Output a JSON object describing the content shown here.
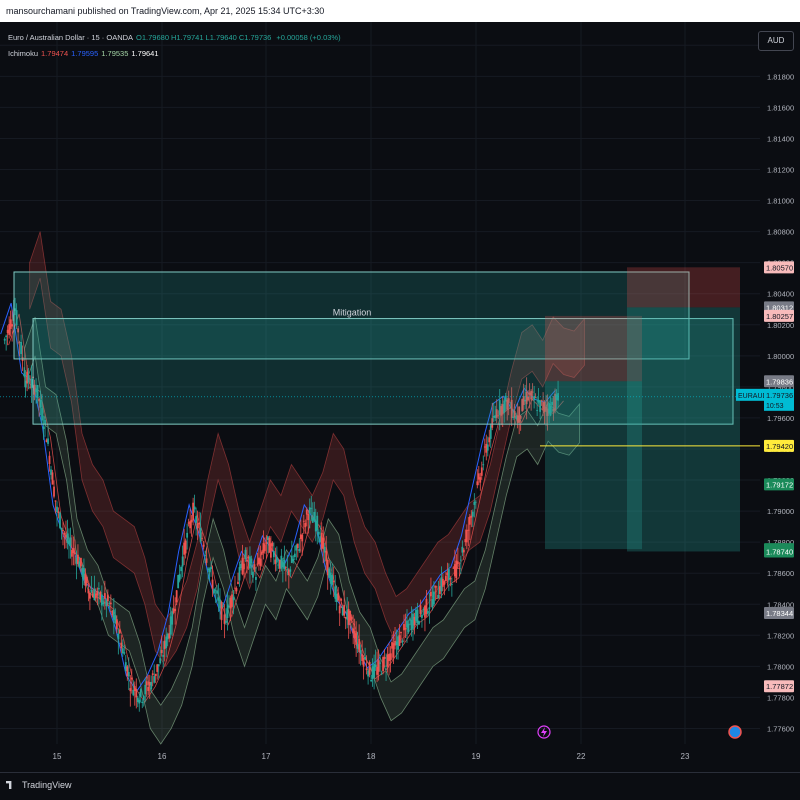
{
  "header": {
    "published_text": "mansourchamani published on TradingView.com, Apr 21, 2025 15:34 UTC+3:30"
  },
  "legend": {
    "symbol_line": "Euro / Australian Dollar · 15 · OANDA",
    "ohlc": [
      {
        "label": "O",
        "value": "1.79680"
      },
      {
        "label": "H",
        "value": "1.79741"
      },
      {
        "label": "L",
        "value": "1.79640"
      },
      {
        "label": "C",
        "value": "1.79736"
      }
    ],
    "change": "+0.00058 (+0.03%)",
    "indicator_name": "Ichimoku",
    "indicator_values": [
      "1.79474",
      "1.79595",
      "1.79535",
      "1.79641"
    ],
    "indicator_colors": [
      "#ef5350",
      "#2962ff",
      "#a5d6a7",
      "#ffffff"
    ]
  },
  "currency_button": "AUD",
  "footer": {
    "logo_text": "TradingView"
  },
  "colors": {
    "up": "#26a69a",
    "down": "#ef5350",
    "zone_fill": "#26a69a",
    "zone_border": "#80cbc4",
    "last_price": "#00bcd4",
    "level_line": "#ffeb3b",
    "background": "#0b0d12"
  },
  "icons": [
    "lightning-icon",
    "calendar-event-icon",
    "tradingview-logo-icon"
  ],
  "chart_data": {
    "type": "candlestick",
    "symbol": "EURAUD",
    "interval": "15",
    "y_range": [
      1.775,
      1.8215
    ],
    "price_ticks": [
      "1.82000",
      "1.81800",
      "1.81600",
      "1.81400",
      "1.81200",
      "1.81000",
      "1.80800",
      "1.80600",
      "1.80400",
      "1.80200",
      "1.80000",
      "1.79800",
      "1.79600",
      "1.79400",
      "1.79200",
      "1.79000",
      "1.78800",
      "1.78600",
      "1.78400",
      "1.78200",
      "1.78000",
      "1.77800",
      "1.77600"
    ],
    "x_ticks": [
      "15",
      "16",
      "17",
      "18",
      "19",
      "22",
      "23"
    ],
    "price_path": [
      [
        14.5,
        1.801
      ],
      [
        14.6,
        1.803
      ],
      [
        14.7,
        1.7985
      ],
      [
        14.8,
        1.798
      ],
      [
        14.9,
        1.795
      ],
      [
        15.0,
        1.79
      ],
      [
        15.1,
        1.788
      ],
      [
        15.2,
        1.787
      ],
      [
        15.3,
        1.785
      ],
      [
        15.4,
        1.7845
      ],
      [
        15.5,
        1.784
      ],
      [
        15.6,
        1.782
      ],
      [
        15.7,
        1.779
      ],
      [
        15.8,
        1.778
      ],
      [
        15.9,
        1.779
      ],
      [
        16.0,
        1.7805
      ],
      [
        16.1,
        1.783
      ],
      [
        16.2,
        1.787
      ],
      [
        16.3,
        1.79
      ],
      [
        16.4,
        1.788
      ],
      [
        16.5,
        1.785
      ],
      [
        16.6,
        1.783
      ],
      [
        16.7,
        1.785
      ],
      [
        16.8,
        1.787
      ],
      [
        16.9,
        1.786
      ],
      [
        17.0,
        1.788
      ],
      [
        17.1,
        1.787
      ],
      [
        17.2,
        1.786
      ],
      [
        17.3,
        1.7875
      ],
      [
        17.4,
        1.79
      ],
      [
        17.5,
        1.789
      ],
      [
        17.6,
        1.786
      ],
      [
        17.7,
        1.784
      ],
      [
        17.8,
        1.783
      ],
      [
        17.9,
        1.781
      ],
      [
        18.0,
        1.7795
      ],
      [
        18.1,
        1.78
      ],
      [
        18.2,
        1.781
      ],
      [
        18.3,
        1.782
      ],
      [
        18.4,
        1.783
      ],
      [
        18.5,
        1.7835
      ],
      [
        18.6,
        1.7845
      ],
      [
        18.7,
        1.7855
      ],
      [
        18.8,
        1.786
      ],
      [
        18.9,
        1.788
      ],
      [
        19.0,
        1.791
      ],
      [
        19.1,
        1.794
      ],
      [
        19.2,
        1.7965
      ],
      [
        19.3,
        1.797
      ],
      [
        19.4,
        1.796
      ],
      [
        19.5,
        1.7975
      ],
      [
        19.6,
        1.7968
      ],
      [
        19.7,
        1.7966
      ],
      [
        19.8,
        1.7974
      ]
    ],
    "zones": [
      {
        "name": "zone-upper",
        "y_top": 1.8054,
        "y_bottom": 1.7998
      },
      {
        "name": "zone-lower",
        "y_top": 1.8024,
        "y_bottom": 1.7956,
        "label": "Mitigation"
      }
    ],
    "positions": [
      {
        "name": "position-1",
        "entry": 1.79836,
        "stop": 1.80257,
        "target": 1.78755
      },
      {
        "name": "position-2",
        "entry": 1.80312,
        "stop": 1.8057,
        "target": 1.7874
      }
    ],
    "horizontal_line": {
      "value": 1.7942,
      "label": "1.79420"
    },
    "last_price": {
      "symbol": "EURAUD",
      "value": "1.79736",
      "countdown": "10:53"
    },
    "price_labels": [
      {
        "value": "1.80570",
        "kind": "stop"
      },
      {
        "value": "1.80312",
        "kind": "entry"
      },
      {
        "value": "1.80257",
        "kind": "stop"
      },
      {
        "value": "1.79836",
        "kind": "entry"
      },
      {
        "value": "1.79420",
        "kind": "level"
      },
      {
        "value": "1.79172",
        "kind": "target"
      },
      {
        "value": "1.78755",
        "kind": "target"
      },
      {
        "value": "1.78740",
        "kind": "target"
      },
      {
        "value": "1.78344",
        "kind": "entry"
      },
      {
        "value": "1.77872",
        "kind": "stop"
      }
    ]
  }
}
